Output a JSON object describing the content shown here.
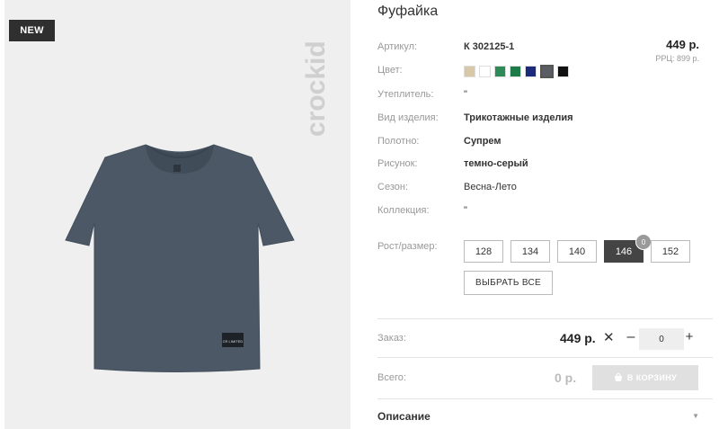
{
  "badge": "NEW",
  "brand": "crockid",
  "shirt_label": "CR LIMITED",
  "title": "Фуфайка",
  "price": "449 р.",
  "rrp": "РРЦ: 899 р.",
  "attributes": [
    {
      "label": "Артикул:",
      "value": "К 302125-1"
    },
    {
      "label": "Цвет:",
      "value": ""
    },
    {
      "label": "Утеплитель:",
      "value": "\""
    },
    {
      "label": "Вид изделия:",
      "value": "Трикотажные изделия"
    },
    {
      "label": "Полотно:",
      "value": "Супрем"
    },
    {
      "label": "Рисунок:",
      "value": "темно-серый"
    },
    {
      "label": "Сезон:",
      "value": "Весна-Лето"
    },
    {
      "label": "Коллекция:",
      "value": "\""
    }
  ],
  "colors": [
    "#d9c8a8",
    "#ffffff",
    "#2e8b57",
    "#1f7a4a",
    "#1b2a7a",
    "#5a5d63",
    "#111111"
  ],
  "selected_color_index": 5,
  "size_label": "Рост/размер:",
  "sizes": [
    "128",
    "134",
    "140",
    "146",
    "152"
  ],
  "selected_size": "146",
  "selected_size_count": "0",
  "select_all": "ВЫБРАТЬ ВСЕ",
  "order": {
    "label": "Заказ:",
    "price": "449 р.",
    "times": "✕",
    "minus": "–",
    "qty": "0",
    "plus": "+"
  },
  "total": {
    "label": "Всего:",
    "value": "0 р."
  },
  "cart_button": "В КОРЗИНУ",
  "description": "Описание"
}
